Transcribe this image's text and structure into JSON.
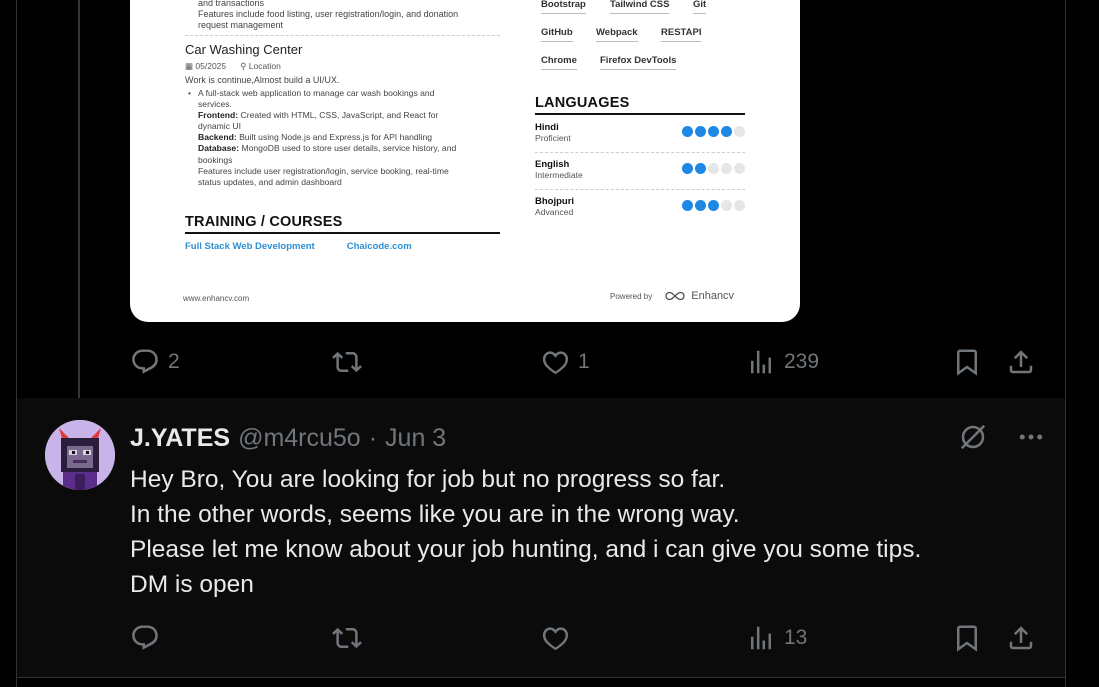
{
  "resume": {
    "top_lines": [
      "and transactions",
      "Features include food listing, user registration/login, and donation",
      "request management"
    ],
    "project_title": "Car Washing Center",
    "project_date": "05/2025",
    "project_location": "Location",
    "project_summary": "Work is continue,Almost build a UI/UX.",
    "bullet_1a": "A full-stack web application to manage car wash bookings and",
    "bullet_1b": "services.",
    "frontend_label": "Frontend:",
    "frontend_a": "Created with HTML, CSS, JavaScript, and React for",
    "frontend_b": "dynamic UI",
    "backend_label": "Backend:",
    "backend_text": "Built using Node.js and Express.js for API handling",
    "database_label": "Database:",
    "database_a": "MongoDB used to store user details, service history, and",
    "database_b": "bookings",
    "features_a": "Features include user registration/login, service booking, real-time",
    "features_b": "status updates, and admin dashboard",
    "training_title": "TRAINING / COURSES",
    "training_items": [
      "Full Stack Web Development",
      "Chaicode.com"
    ],
    "skills": [
      "Bootstrap",
      "Tailwind CSS",
      "Git",
      "GitHub",
      "Webpack",
      "RESTAPI",
      "Chrome",
      "Firefox DevTools"
    ],
    "languages_title": "LANGUAGES",
    "languages": [
      {
        "name": "Hindi",
        "level": "Proficient",
        "dots": 4
      },
      {
        "name": "English",
        "level": "Intermediate",
        "dots": 2
      },
      {
        "name": "Bhojpuri",
        "level": "Advanced",
        "dots": 3
      }
    ],
    "footer_url": "www.enhancv.com",
    "powered_by": "Powered by",
    "brand": "Enhancv"
  },
  "post_actions": {
    "replies": "2",
    "reposts": "",
    "likes": "1",
    "views": "239"
  },
  "reply": {
    "display_name": "J.YATES",
    "handle": "@m4rcu5o",
    "separator": "·",
    "date": "Jun 3",
    "lines": [
      "Hey Bro, You are looking for job but no progress so far.",
      "In the other words, seems like you are in the wrong way.",
      "Please let me know about your job hunting, and i can give you some tips.",
      "DM is open"
    ],
    "actions": {
      "replies": "",
      "reposts": "",
      "likes": "",
      "views": "13"
    }
  },
  "colors": {
    "accent": "#1e88e5",
    "link": "#2d8fd5",
    "muted": "#71767b",
    "text": "#e7e9ea"
  }
}
